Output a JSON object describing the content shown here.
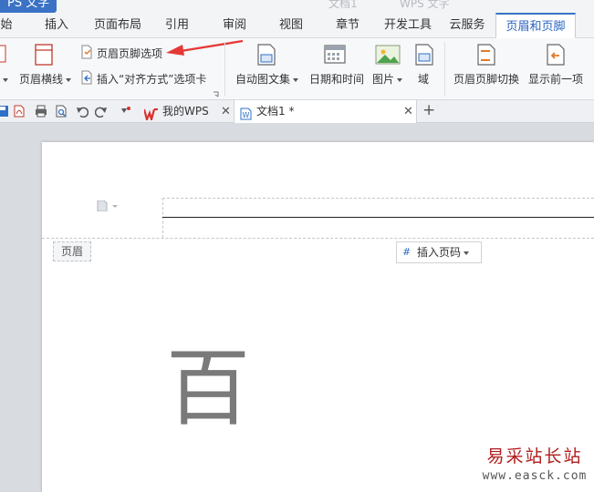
{
  "titlebar": {
    "app_badge": "PS 文字",
    "ghost_doc": "文档1",
    "ghost_app": "WPS 文字"
  },
  "tabs": [
    {
      "label": "始",
      "active": false
    },
    {
      "label": "插入",
      "active": false
    },
    {
      "label": "页面布局",
      "active": false
    },
    {
      "label": "引用",
      "active": false
    },
    {
      "label": "审阅",
      "active": false
    },
    {
      "label": "视图",
      "active": false
    },
    {
      "label": "章节",
      "active": false
    },
    {
      "label": "开发工具",
      "active": false
    },
    {
      "label": "云服务",
      "active": false
    },
    {
      "label": "页眉和页脚",
      "active": true
    }
  ],
  "ribbon": {
    "header_line_label": "页眉横线",
    "header_footer_options": "页眉页脚选项",
    "insert_align_tab": "插入“对齐方式”选项卡",
    "auto_text": "自动图文集",
    "date_time": "日期和时间",
    "picture": "图片",
    "field": "域",
    "switch_header_footer": "页眉页脚切换",
    "show_previous": "显示前一项"
  },
  "doc_tabs": {
    "my_wps": "我的WPS",
    "doc1": "文档1 *",
    "add": "+"
  },
  "page": {
    "header_tag": "页眉",
    "insert_page_number": "插入页码",
    "body_text": "百"
  },
  "watermark": {
    "name": "易采站长站",
    "url": "www.easck.com"
  },
  "colors": {
    "accent": "#3b72c6",
    "arrow": "#e53935",
    "wps_red": "#d9302e"
  }
}
